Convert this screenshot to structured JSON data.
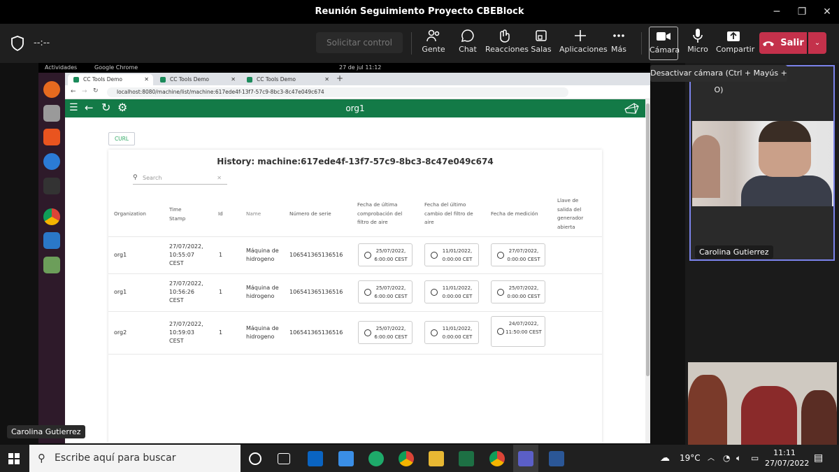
{
  "teams": {
    "window_title": "Reunión Seguimiento Proyecto CBEBlock",
    "timer": "--:--",
    "request_control": "Solicitar control",
    "tools": [
      {
        "label": "Gente",
        "icon": "people-icon"
      },
      {
        "label": "Chat",
        "icon": "chat-icon"
      },
      {
        "label": "Reacciones",
        "icon": "reactions-icon"
      },
      {
        "label": "Salas",
        "icon": "rooms-icon"
      },
      {
        "label": "Aplicaciones",
        "icon": "plus-icon"
      },
      {
        "label": "Más",
        "icon": "more-icon"
      },
      {
        "label": "Cámara",
        "icon": "camera-icon"
      },
      {
        "label": "Micro",
        "icon": "mic-icon"
      },
      {
        "label": "Compartir",
        "icon": "share-icon"
      }
    ],
    "leave_label": "Salir",
    "tooltip": "Desactivar cámara (Ctrl + Mayús + O)",
    "participant_1": "Carolina Gutierrez",
    "presenter_label": "Carolina Gutierrez"
  },
  "desktop": {
    "activities": "Actividades",
    "app_name": "Google Chrome",
    "clock": "27 de jul  11:12"
  },
  "browser": {
    "tabs": [
      "CC Tools Demo",
      "CC Tools Demo",
      "CC Tools Demo"
    ],
    "url": "localhost:8080/machine/list/machine:617ede4f-13f7-57c9-8bc3-8c47e049c674"
  },
  "app": {
    "org_title": "org1",
    "curl_label": "CURL",
    "history_title": "History: machine:617ede4f-13f7-57c9-8bc3-8c47e049c674",
    "search_placeholder": "Search",
    "headers": [
      "Organization",
      "Time Stamp",
      "Id",
      "Name",
      "Número de serie",
      "Fecha de última comprobación del filtro de aire",
      "Fecha del último cambio del filtro de aire",
      "Fecha de medición",
      "Llave de salida del generador abierta"
    ],
    "rows": [
      {
        "org": "org1",
        "ts": "27/07/2022, 10:55:07 CEST",
        "id": "1",
        "name": "Máquina de hidrogeno",
        "serial": "106541365136516",
        "d1": "25/07/2022, 6:00:00 CEST",
        "d2": "11/01/2022, 0:00:00 CET",
        "d3": "27/07/2022, 0:00:00 CEST"
      },
      {
        "org": "org1",
        "ts": "27/07/2022, 10:56:26 CEST",
        "id": "1",
        "name": "Máquina de hidrogeno",
        "serial": "106541365136516",
        "d1": "25/07/2022, 6:00:00 CEST",
        "d2": "11/01/2022, 0:00:00 CET",
        "d3": "25/07/2022, 0:00:00 CEST"
      },
      {
        "org": "org2",
        "ts": "27/07/2022, 10:59:03 CEST",
        "id": "1",
        "name": "Máquina de hidrogeno",
        "serial": "106541365136516",
        "d1": "25/07/2022, 6:00:00 CEST",
        "d2": "11/01/2022, 0:00:00 CET",
        "d3": "24/07/2022, 11:50:00 CEST"
      }
    ]
  },
  "taskbar": {
    "search_placeholder": "Escribe aquí para buscar",
    "weather": "19°C",
    "time": "11:11",
    "date": "27/07/2022"
  },
  "colors": {
    "app_green": "#137a47",
    "leave_red": "#c4314b",
    "teams_accent": "#7b83eb"
  }
}
